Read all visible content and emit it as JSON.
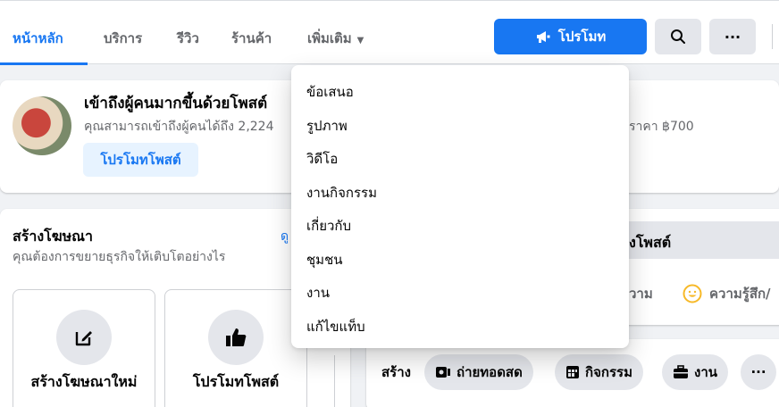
{
  "nav": {
    "tabs": [
      {
        "label": "หน้าหลัก",
        "active": true
      },
      {
        "label": "บริการ"
      },
      {
        "label": "รีวิว"
      },
      {
        "label": "ร้านค้า"
      },
      {
        "label": "เพิ่มเติม"
      }
    ],
    "promote_label": "โปรโมท",
    "more_icon_label": "···",
    "search_icon": "search-icon",
    "accent_color": "#1877f2"
  },
  "boost_card": {
    "title": "เข้าถึงผู้คนมากขึ้นด้วยโพสต์",
    "subtitle": "คุณสามารถเข้าถึงผู้คนได้ถึง 2,224",
    "button_label": "โปรโมทโพสต์",
    "right_text": "ราคา ฿700"
  },
  "ads_card": {
    "title": "สร้างโฆษณา",
    "subtitle": "คุณต้องการขยายธุรกิจให้เติบโตอย่างไร",
    "link_label": "ดู",
    "tiles": [
      {
        "label": "สร้างโฆษณาใหม่",
        "icon": "edit-icon"
      },
      {
        "label": "โปรโมทโพสต์",
        "icon": "thumbs-up-icon"
      }
    ]
  },
  "composer": {
    "header": "งโพสต์",
    "options": [
      {
        "label": "วาม"
      },
      {
        "label": "ความรู้สึก/",
        "icon": "smiley-icon"
      }
    ],
    "create_label": "สร้าง",
    "actions": [
      {
        "label": "ถ่ายทอดสด",
        "icon": "live-video-icon"
      },
      {
        "label": "กิจกรรม",
        "icon": "calendar-icon"
      },
      {
        "label": "งาน",
        "icon": "briefcase-icon"
      },
      {
        "label": "···",
        "icon": "more-icon"
      }
    ]
  },
  "dropdown_menu": {
    "items": [
      "ข้อเสนอ",
      "รูปภาพ",
      "วิดีโอ",
      "งานกิจกรรม",
      "เกี่ยวกับ",
      "ชุมชน",
      "งาน",
      "แก้ไขแท็บ"
    ]
  }
}
